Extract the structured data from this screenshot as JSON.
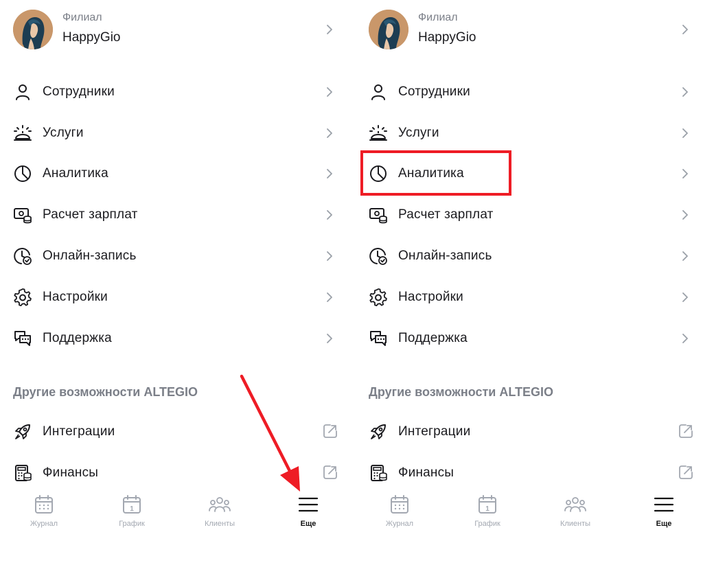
{
  "panels": [
    {
      "branch": {
        "caption": "Филиал",
        "name": "HappyGio"
      },
      "menu": [
        {
          "label": "Сотрудники",
          "icon": "user-icon"
        },
        {
          "label": "Услуги",
          "icon": "service-bell-icon"
        },
        {
          "label": "Аналитика",
          "icon": "pie-chart-icon"
        },
        {
          "label": "Расчет зарплат",
          "icon": "payroll-icon"
        },
        {
          "label": "Онлайн-запись",
          "icon": "clock-check-icon"
        },
        {
          "label": "Настройки",
          "icon": "gear-icon"
        },
        {
          "label": "Поддержка",
          "icon": "chat-bubbles-icon"
        }
      ],
      "section_title": "Другие возможности ALTEGIO",
      "external": [
        {
          "label": "Интеграции",
          "icon": "rocket-icon"
        },
        {
          "label": "Финансы",
          "icon": "calculator-icon"
        }
      ],
      "tabs": [
        {
          "label": "Журнал",
          "icon": "calendar-dots-icon",
          "active": false
        },
        {
          "label": "График",
          "icon": "calendar-day-icon",
          "active": false
        },
        {
          "label": "Клиенты",
          "icon": "people-icon",
          "active": false
        },
        {
          "label": "Еще",
          "icon": "menu-icon",
          "active": true
        }
      ]
    },
    {
      "branch": {
        "caption": "Филиал",
        "name": "HappyGio"
      },
      "menu": [
        {
          "label": "Сотрудники",
          "icon": "user-icon"
        },
        {
          "label": "Услуги",
          "icon": "service-bell-icon"
        },
        {
          "label": "Аналитика",
          "icon": "pie-chart-icon"
        },
        {
          "label": "Расчет зарплат",
          "icon": "payroll-icon"
        },
        {
          "label": "Онлайн-запись",
          "icon": "clock-check-icon"
        },
        {
          "label": "Настройки",
          "icon": "gear-icon"
        },
        {
          "label": "Поддержка",
          "icon": "chat-bubbles-icon"
        }
      ],
      "section_title": "Другие возможности ALTEGIO",
      "external": [
        {
          "label": "Интеграции",
          "icon": "rocket-icon"
        },
        {
          "label": "Финансы",
          "icon": "calculator-icon"
        }
      ],
      "tabs": [
        {
          "label": "Журнал",
          "icon": "calendar-dots-icon",
          "active": false
        },
        {
          "label": "График",
          "icon": "calendar-day-icon",
          "active": false
        },
        {
          "label": "Клиенты",
          "icon": "people-icon",
          "active": false
        },
        {
          "label": "Еще",
          "icon": "menu-icon",
          "active": true
        }
      ]
    }
  ],
  "tab_day_number": "1",
  "annotations": {
    "highlight_color": "#ee1c25",
    "arrow_color": "#ee1c25",
    "accent_text": "#1b1b1f",
    "muted_text": "#7b7f88"
  }
}
